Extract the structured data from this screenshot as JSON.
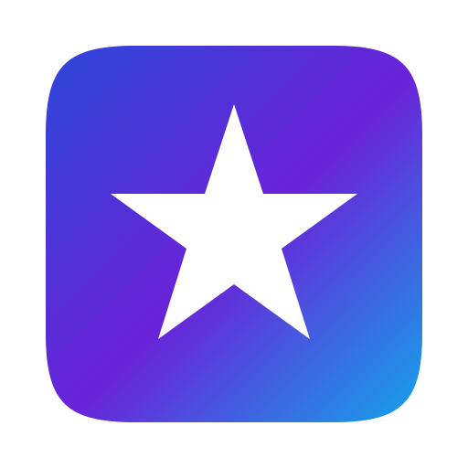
{
  "app_icon": {
    "icon": "star-icon",
    "gradient": {
      "start": "#2d48d9",
      "middle": "#6a22d8",
      "end": "#14a4ea"
    },
    "star_color": "#ffffff"
  }
}
